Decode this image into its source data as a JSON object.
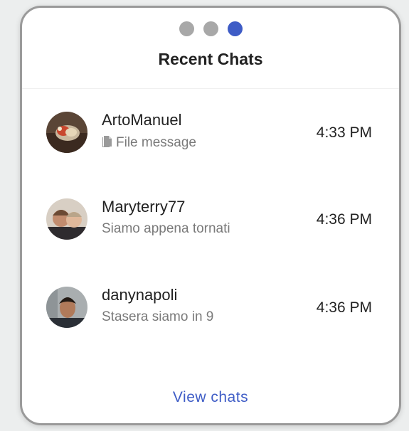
{
  "widget": {
    "title": "Recent Chats",
    "pagination": {
      "pages": 3,
      "active_page": 3
    },
    "view_chats_label": "View chats",
    "accent_color": "#3e5cc6"
  },
  "chats": [
    {
      "name": "ArtoManuel",
      "preview": "File message",
      "preview_icon": "file-icon",
      "time": "4:33 PM",
      "avatar": "food-photo-avatar"
    },
    {
      "name": "Maryterry77",
      "preview": "Siamo appena tornati",
      "time": "4:36 PM",
      "avatar": "couple-selfie-avatar"
    },
    {
      "name": "danynapoli",
      "preview": "Stasera siamo in 9",
      "time": "4:36 PM",
      "avatar": "man-portrait-avatar"
    }
  ]
}
